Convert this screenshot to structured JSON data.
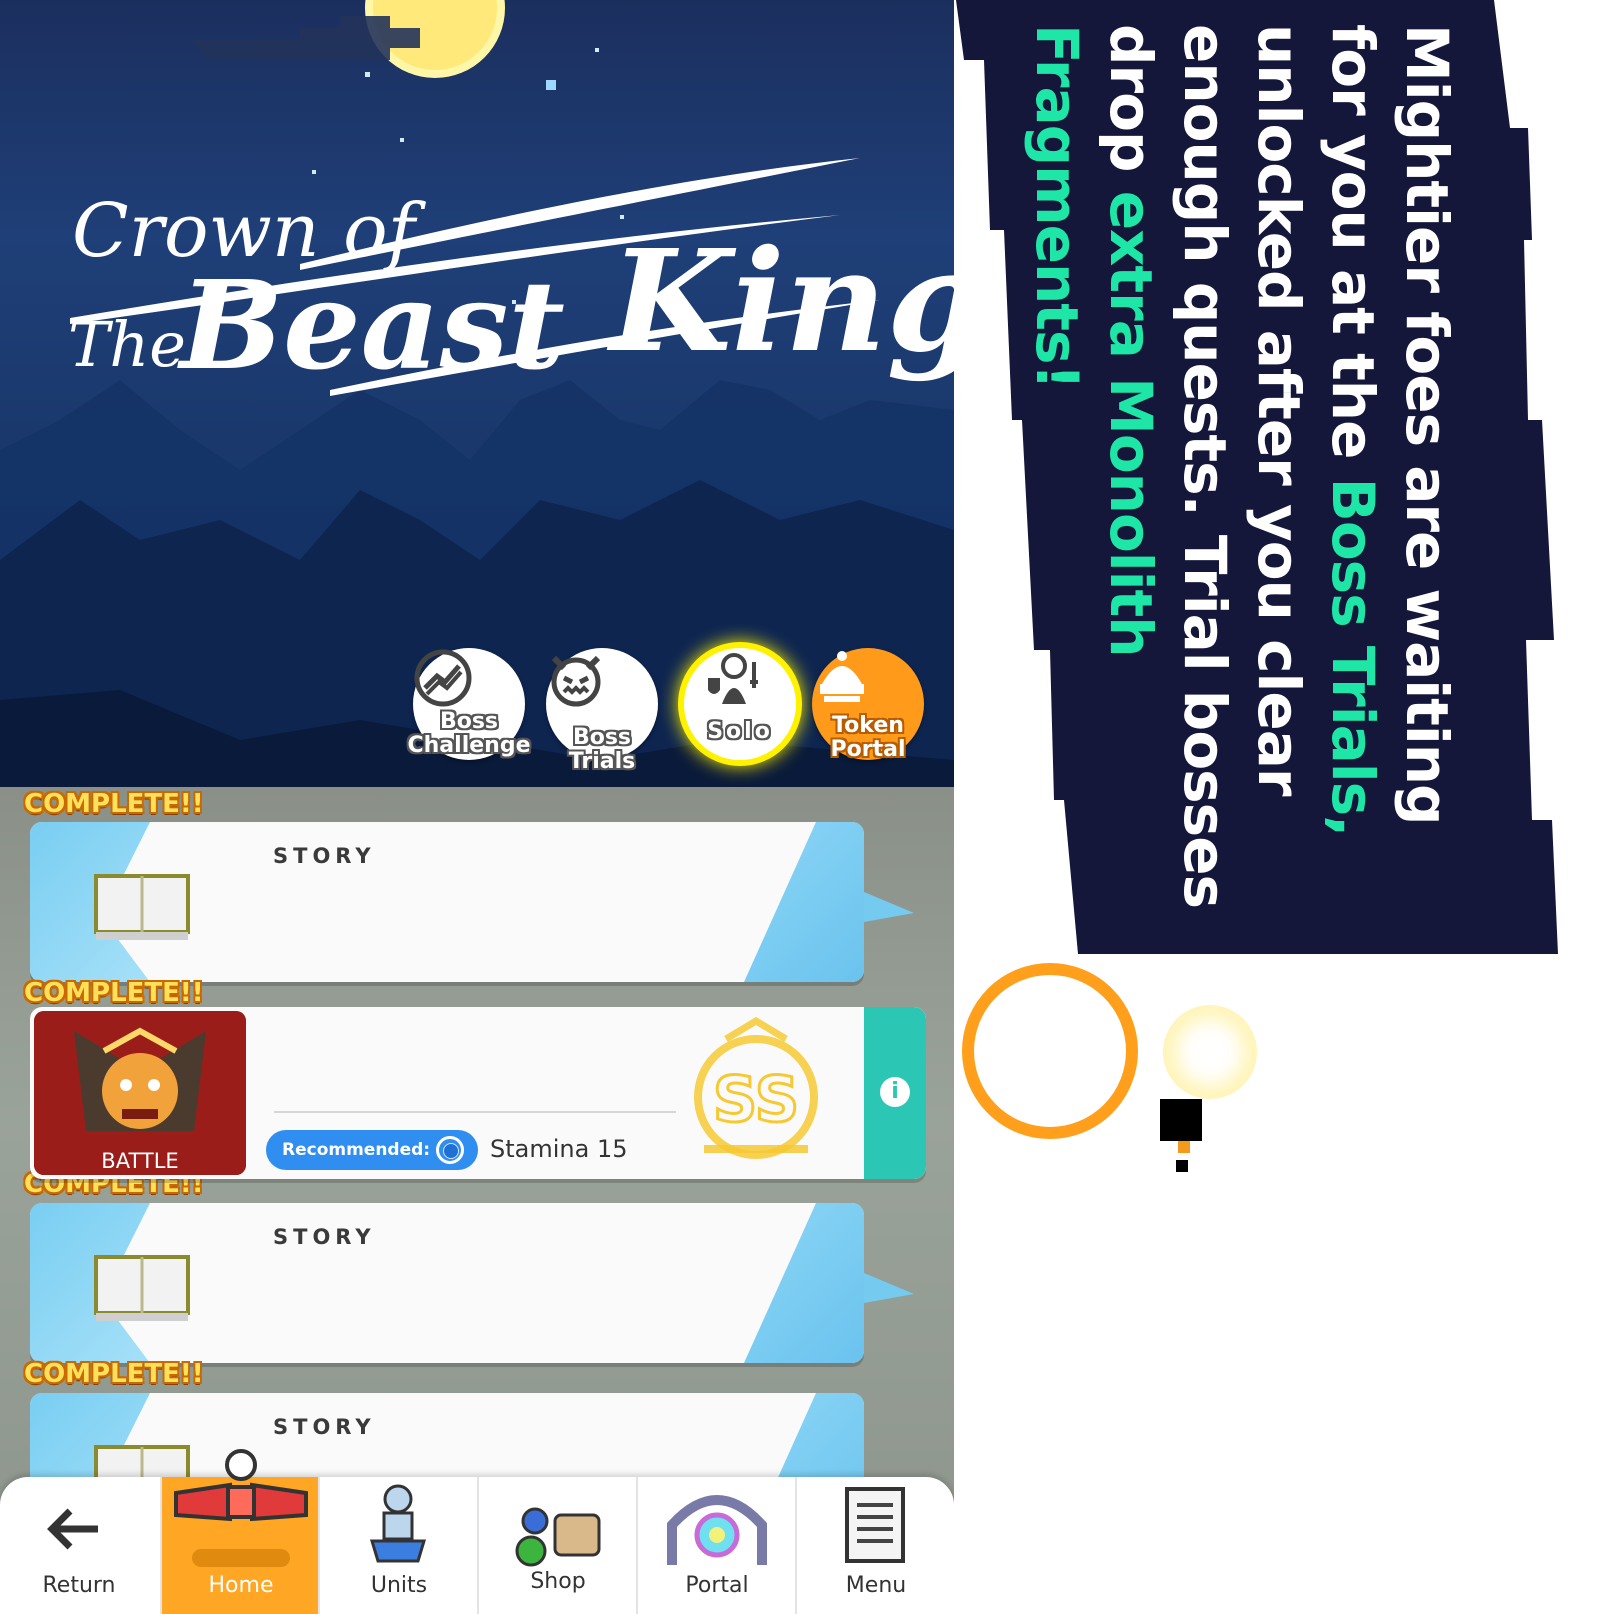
{
  "banner": {
    "logo": {
      "line1": "Crown of",
      "line2_small": "The",
      "line2_big": "Beast",
      "line3": "King"
    }
  },
  "modes": [
    {
      "label": "Boss Challenge",
      "line1": "Boss",
      "line2": "Challenge",
      "icon": "trending-chart-icon"
    },
    {
      "label": "Boss Trials",
      "icon": "demon-face-icon"
    },
    {
      "label": "Solo",
      "icon": "solo-hero-icon",
      "selected": true
    },
    {
      "label": "Token Portal",
      "line1": "Token",
      "line2": "Portal",
      "icon": "tower-dome-icon"
    }
  ],
  "quests": [
    {
      "status": "COMPLETE!!",
      "type": "STORY",
      "icon": "book-icon"
    },
    {
      "status": "COMPLETE!!",
      "type": "BATTLE",
      "recommended_label": "Recommended:",
      "stamina": "Stamina 15",
      "rank": "SS",
      "icon": "info-icon"
    },
    {
      "status": "COMPLETE!!",
      "type": "STORY",
      "icon": "book-icon"
    },
    {
      "status": "COMPLETE!!",
      "type": "STORY",
      "icon": "book-icon"
    }
  ],
  "nav": [
    {
      "label": "Return",
      "icon": "arrow-left-icon"
    },
    {
      "label": "Home",
      "icon": "home-bow-icon",
      "active": true
    },
    {
      "label": "Units",
      "icon": "unit-figure-icon"
    },
    {
      "label": "Shop",
      "icon": "shop-items-icon"
    },
    {
      "label": "Portal",
      "icon": "portal-gate-icon"
    },
    {
      "label": "Menu",
      "icon": "menu-list-icon"
    }
  ],
  "promo": {
    "t1": "Mightier foes are waiting for you at the ",
    "t2": "Boss Trials,",
    "t3": " unlocked after you clear enough quests. Trial bosses drop ",
    "t4": "extra Monolith Fragments!"
  },
  "colors": {
    "promo_bg": "#14163a",
    "accent_green": "#1ee6a6",
    "nav_active": "#ffa624",
    "info_tab": "#2cc7b4",
    "rec_pill": "#2f8ef0"
  }
}
